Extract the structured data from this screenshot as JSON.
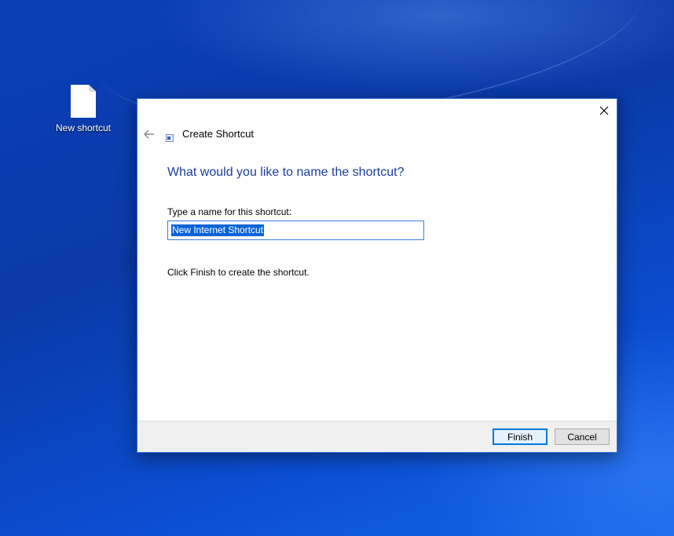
{
  "desktop": {
    "shortcut_icon": {
      "label": "New shortcut",
      "icon": "blank-file-icon"
    }
  },
  "dialog": {
    "title": "Create Shortcut",
    "title_icon": "shortcut-icon",
    "heading": "What would you like to name the shortcut?",
    "name_field": {
      "label": "Type a name for this shortcut:",
      "value": "New Internet Shortcut",
      "selected": true
    },
    "hint": "Click Finish to create the shortcut.",
    "buttons": {
      "finish": "Finish",
      "cancel": "Cancel"
    },
    "controls": {
      "back_icon": "back-arrow-icon",
      "close_icon": "close-icon"
    }
  },
  "colors": {
    "heading": "#1a3d9e",
    "selection": "#0a64d8",
    "primary_button_border": "#0078d7"
  }
}
